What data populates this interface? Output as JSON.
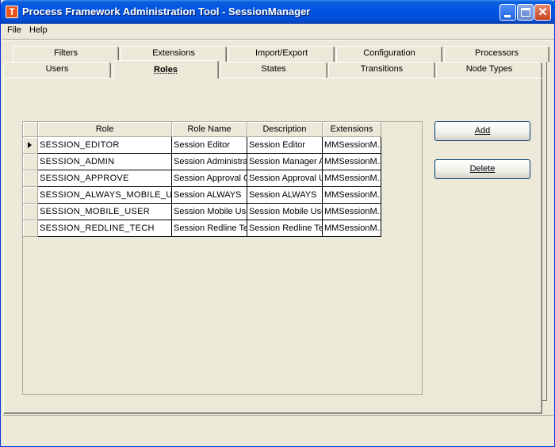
{
  "window": {
    "title": "Process Framework Administration Tool - SessionManager",
    "icon_letter": "T",
    "close_glyph": "✕"
  },
  "menu": [
    {
      "label": "File"
    },
    {
      "label": "Help"
    }
  ],
  "tabs_back_row": [
    {
      "label": "Filters"
    },
    {
      "label": "Extensions"
    },
    {
      "label": "Import/Export"
    },
    {
      "label": "Configuration"
    },
    {
      "label": "Processors"
    }
  ],
  "tabs_front_row": [
    {
      "label": "Users"
    },
    {
      "label": "Roles"
    },
    {
      "label": "States"
    },
    {
      "label": "Transitions"
    },
    {
      "label": "Node Types"
    }
  ],
  "selected_tab": "Roles",
  "grid": {
    "columns": [
      {
        "label": "Role"
      },
      {
        "label": "Role Name"
      },
      {
        "label": "Description"
      },
      {
        "label": "Extensions"
      }
    ],
    "rows": [
      {
        "role": "SESSION_EDITOR",
        "role_name": "Session Editor",
        "description": "Session Editor",
        "extensions": "MMSessionM..."
      },
      {
        "role": "SESSION_ADMIN",
        "role_name": "Session Administra",
        "description": "Session Manager A",
        "extensions": "MMSessionM..."
      },
      {
        "role": "SESSION_APPROVE",
        "role_name": "Session Approval C",
        "description": "Session Approval U",
        "extensions": "MMSessionM..."
      },
      {
        "role": "SESSION_ALWAYS_MOBILE_US",
        "role_name": "Session ALWAYS",
        "description": "Session ALWAYS",
        "extensions": "MMSessionM..."
      },
      {
        "role": "SESSION_MOBILE_USER",
        "role_name": "Session Mobile Use",
        "description": "Session Mobile Use",
        "extensions": "MMSessionM..."
      },
      {
        "role": "SESSION_REDLINE_TECH",
        "role_name": "Session Redline Te",
        "description": "Session Redline Te",
        "extensions": "MMSessionM..."
      }
    ]
  },
  "buttons": {
    "add": "Add",
    "delete": "Delete"
  }
}
